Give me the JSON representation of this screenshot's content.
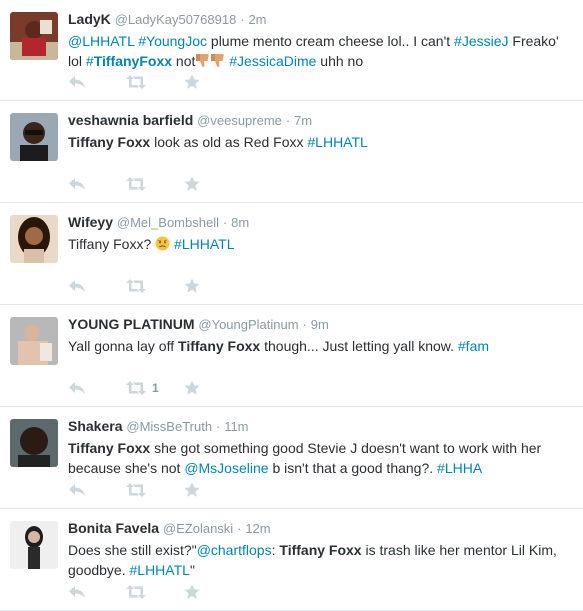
{
  "tweets": [
    {
      "fullname": "LadyK",
      "username": "@LadyKay50768918",
      "sep": "·",
      "time": "2m",
      "avatar_icon": "avatar-ladyk",
      "lines": [
        [
          {
            "t": "@LHHATL",
            "c": "link"
          },
          {
            "t": " "
          },
          {
            "t": "#YoungJoc",
            "c": "link"
          },
          {
            "t": " plume mento cream cheese lol.. I can't "
          },
          {
            "t": "#JessieJ",
            "c": "link"
          },
          {
            "t": " Freako'"
          }
        ],
        [
          {
            "t": "lol "
          },
          {
            "t": "#",
            "c": "link"
          },
          {
            "t": "TiffanyFoxx",
            "c": "link strong"
          },
          {
            "t": " not"
          },
          {
            "e": "thumbs-down-emoji"
          },
          {
            "e": "thumbs-down-emoji"
          },
          {
            "t": " "
          },
          {
            "t": "#JessicaDime",
            "c": "link"
          },
          {
            "t": " uhh no"
          }
        ]
      ],
      "retweet_count": ""
    },
    {
      "fullname": "veshawnia barfield",
      "username": "@veesupreme",
      "sep": "·",
      "time": "7m",
      "avatar_icon": "avatar-veshawnia",
      "lines": [
        [
          {
            "t": "Tiffany Foxx",
            "c": "strong"
          },
          {
            "t": " look as old as Red Foxx "
          },
          {
            "t": "#LHHATL",
            "c": "link"
          }
        ]
      ],
      "retweet_count": ""
    },
    {
      "fullname": "Wifeyy",
      "username": "@Mel_Bombshell",
      "sep": "·",
      "time": "8m",
      "avatar_icon": "avatar-wifeyy",
      "lines": [
        [
          {
            "t": "Tiffany Foxx? "
          },
          {
            "e": "disappointed-face-emoji"
          },
          {
            "t": " "
          },
          {
            "t": "#LHHATL",
            "c": "link"
          }
        ]
      ],
      "retweet_count": ""
    },
    {
      "fullname": "YOUNG PLATINUM",
      "username": "@YoungPlatinum",
      "sep": "·",
      "time": "9m",
      "avatar_icon": "avatar-youngplatinum",
      "lines": [
        [
          {
            "t": "Yall gonna lay off "
          },
          {
            "t": "Tiffany Foxx",
            "c": "strong"
          },
          {
            "t": " though... Just letting yall know. "
          },
          {
            "t": "#fam",
            "c": "link"
          }
        ]
      ],
      "retweet_count": "1"
    },
    {
      "fullname": "Shakera",
      "username": "@MissBeTruth",
      "sep": "·",
      "time": "11m",
      "avatar_icon": "avatar-shakera",
      "lines": [
        [
          {
            "t": "Tiffany Foxx",
            "c": "strong"
          },
          {
            "t": " she got something good  Stevie J doesn't want to work with her"
          }
        ],
        [
          {
            "t": "because she's not "
          },
          {
            "t": "@MsJoseline",
            "c": "link"
          },
          {
            "t": " b isn't that a good thang?. "
          },
          {
            "t": "#LHHA",
            "c": "link"
          }
        ]
      ],
      "retweet_count": ""
    },
    {
      "fullname": "Bonita Favela",
      "username": "@EZolanski",
      "sep": "·",
      "time": "12m",
      "avatar_icon": "avatar-bonita",
      "lines": [
        [
          {
            "t": "Does she still exist?\""
          },
          {
            "t": "@chartflops",
            "c": "link"
          },
          {
            "t": ": "
          },
          {
            "t": "Tiffany Foxx",
            "c": "strong"
          },
          {
            "t": " is trash like her mentor Lil Kim,"
          }
        ],
        [
          {
            "t": "goodbye. "
          },
          {
            "t": "#LHHATL",
            "c": "link"
          },
          {
            "t": "\""
          }
        ]
      ],
      "retweet_count": ""
    }
  ],
  "colors": {
    "link": "#0084b4",
    "muted": "#8899a6",
    "icon": "#ccd6dd",
    "text": "#292f33",
    "divider": "#e1e8ed"
  },
  "action_icons": [
    "reply-icon",
    "retweet-icon",
    "favorite-icon"
  ]
}
